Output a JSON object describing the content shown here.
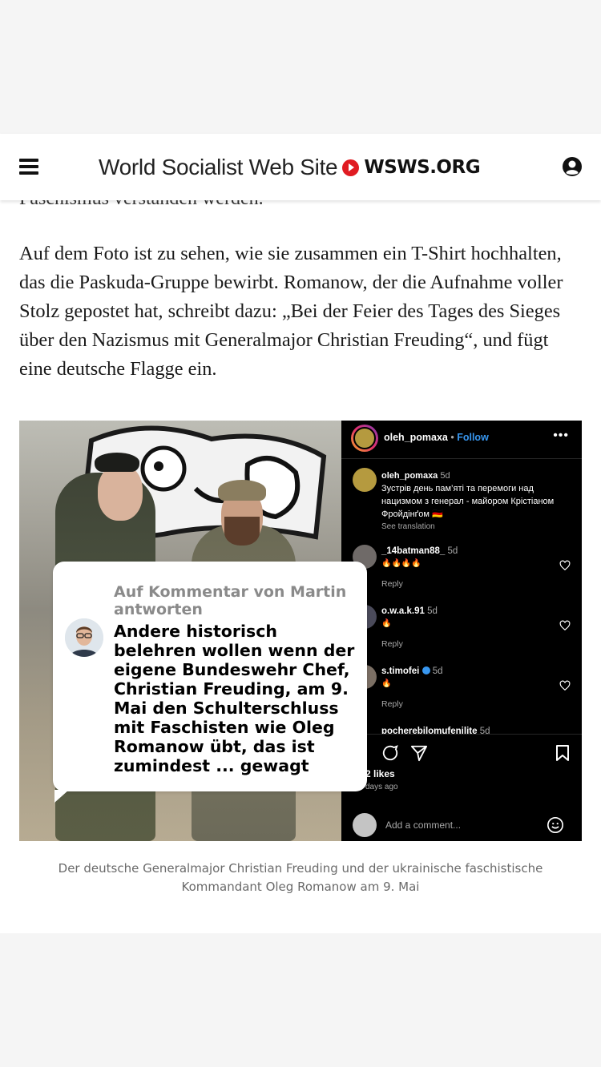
{
  "header": {
    "site_name": "World Socialist Web Site",
    "site_domain": "WSWS.ORG",
    "menu_icon": "hamburger-menu-icon",
    "account_icon": "user-account-icon",
    "brand_red": "#e01b22"
  },
  "article": {
    "cutoff_line": "Faschismus verstanden werden.",
    "paragraph": "Auf dem Foto ist zu sehen, wie sie zusammen ein T-Shirt hochhalten, das die Paskuda-Gruppe bewirbt. Romanow, der die Aufnahme voller Stolz gepostet hat, schreibt dazu: „Bei der Feier des Tages des Sieges über den Nazismus mit Generalmajor Christian Freuding“, und fügt eine deutsche Flagge ein.",
    "image_caption": "Der deutsche Generalmajor Christian Freuding und der ukrainische faschistische Kommandant Oleg Romanow am 9. Mai"
  },
  "instagram": {
    "username": "oleh_pomaxa",
    "separator": " • ",
    "follow_label": "Follow",
    "more_icon": "more-dots-icon",
    "caption_user": "oleh_pomaxa",
    "caption_age": "5d",
    "caption_text": "Зустрів день пам’яті та перемоги над нацизмом з генерал - майором Крістіаном Фройдінґом 🇩🇪",
    "see_translation": "See translation",
    "comments": [
      {
        "name": "_14batman88_",
        "age": "5d",
        "text": "🔥🔥🔥🔥",
        "reply": "Reply"
      },
      {
        "name": "o.w.a.k.91",
        "age": "5d",
        "text": "🔥",
        "reply": "Reply"
      },
      {
        "name": "s.timofei",
        "age": "5d",
        "text": "🔥",
        "reply": "Reply"
      },
      {
        "name": "pocherebilomufenilite",
        "age": "5d",
        "text": "",
        "reply": ""
      }
    ],
    "likes": "2 likes",
    "days_ago": "days ago",
    "add_comment_placeholder": "Add a comment..."
  },
  "comment_card": {
    "reply_to": "Auf Kommentar von Martin antworten",
    "text": "Andere historisch belehren wollen wenn der eigene Bundeswehr Chef, Christian Freuding, am 9. Mai den Schulterschluss mit Faschisten wie Oleg Romanow übt, das ist zumindest ... gewagt"
  }
}
